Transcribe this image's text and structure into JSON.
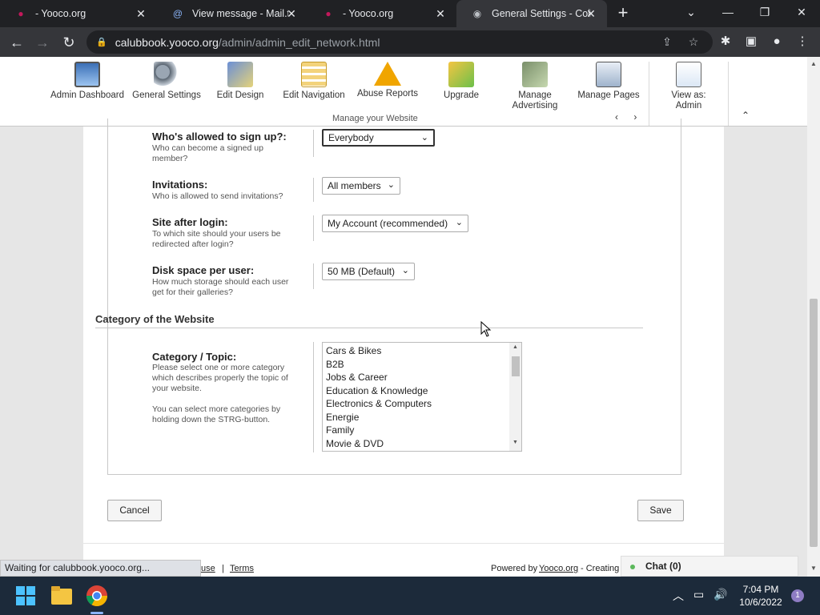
{
  "browser": {
    "tabs": [
      {
        "title": "- Yooco.org",
        "active": false
      },
      {
        "title": "View message - Mail.tn",
        "active": false
      },
      {
        "title": "- Yooco.org",
        "active": false
      },
      {
        "title": "General Settings - Colla",
        "active": true
      }
    ],
    "url_host": "calubbook.yooco.org",
    "url_path": "/admin/admin_edit_network.html",
    "status": "Waiting for calubbook.yooco.org..."
  },
  "adminbar": {
    "items": [
      {
        "label": "Admin Dashboard",
        "icon": "monitor-icon"
      },
      {
        "label": "General Settings",
        "icon": "gears-icon"
      },
      {
        "label": "Edit Design",
        "icon": "design-icon"
      },
      {
        "label": "Edit Navigation",
        "icon": "navigation-icon"
      },
      {
        "label": "Abuse Reports",
        "icon": "warning-icon"
      },
      {
        "label": "Upgrade",
        "icon": "upgrade-icon"
      },
      {
        "label": "Manage Advertising",
        "icon": "money-icon"
      },
      {
        "label": "Manage Pages",
        "icon": "pages-icon"
      }
    ],
    "view_as": "View as: Admin",
    "group_label": "Manage your Website"
  },
  "form": {
    "signup_label": "Who's allowed to sign up?:",
    "signup_help": "Who can become a signed up member?",
    "signup_value": "Everybody",
    "invitations_label": "Invitations:",
    "invitations_help": "Who is allowed to send invitations?",
    "invitations_value": "All members",
    "afterlogin_label": "Site after login:",
    "afterlogin_help": "To which site should your users be redirected after login?",
    "afterlogin_value": "My Account (recommended)",
    "disk_label": "Disk space per user:",
    "disk_help": "How much storage should each user get for their galleries?",
    "disk_value": "50 MB (Default)",
    "category_section": "Category of the Website",
    "category_label": "Category / Topic:",
    "category_help1": "Please select one or more category which describes properly the topic of your website.",
    "category_help2": "You can select more categories by holding down the STRG-button.",
    "categories": [
      "Cars & Bikes",
      "B2B",
      "Jobs & Career",
      "Education & Knowledge",
      "Electronics & Computers",
      "Energie",
      "Family",
      "Movie & DVD"
    ]
  },
  "buttons": {
    "cancel": "Cancel",
    "save": "Save"
  },
  "footer": {
    "use": "use",
    "sep": "|",
    "terms": "Terms",
    "powered": "Powered by",
    "yooco": "Yooco.org",
    "creating": "- Creating"
  },
  "chat": {
    "label": "Chat (0)"
  },
  "taskbar": {
    "time": "7:04 PM",
    "date": "10/6/2022",
    "notifications": "1"
  }
}
